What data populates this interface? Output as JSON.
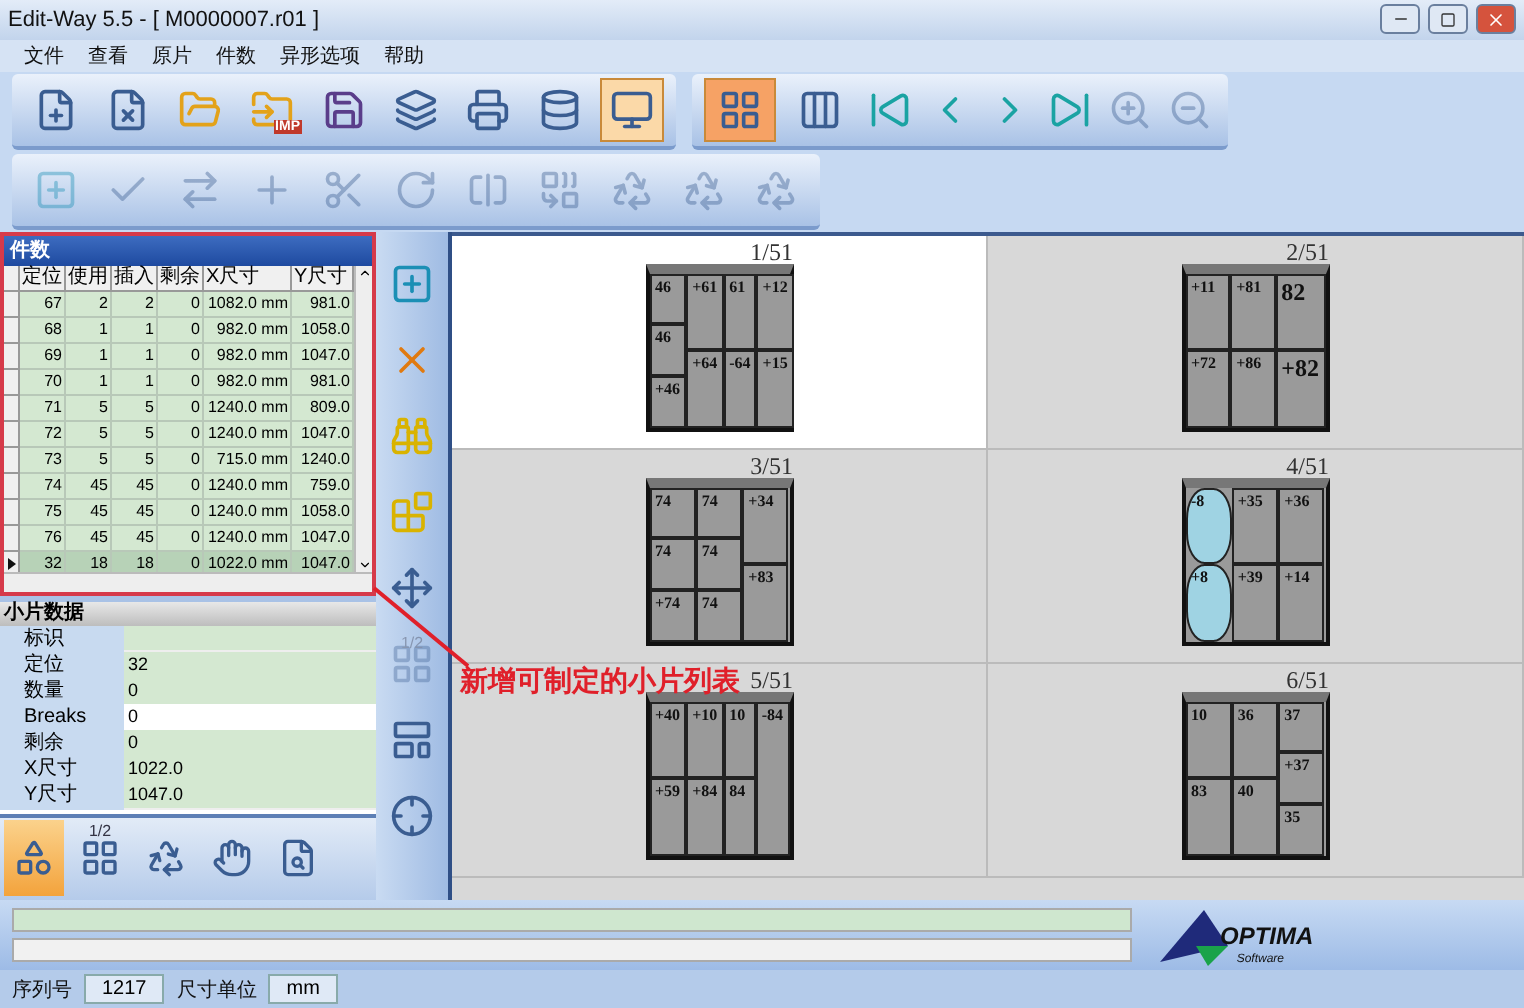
{
  "window": {
    "title": "Edit-Way 5.5  - [ M0000007.r01 ]"
  },
  "menu": [
    "文件",
    "查看",
    "原片",
    "件数",
    "异形选项",
    "帮助"
  ],
  "toolbar_main": [
    {
      "kind": "new",
      "selected": false
    },
    {
      "kind": "close",
      "selected": false
    },
    {
      "kind": "open",
      "selected": false
    },
    {
      "kind": "import",
      "selected": false,
      "label": "IMP"
    },
    {
      "kind": "save",
      "selected": false
    },
    {
      "kind": "layers",
      "selected": false
    },
    {
      "kind": "print",
      "selected": false
    },
    {
      "kind": "stack",
      "selected": false
    },
    {
      "kind": "export",
      "selected": true
    }
  ],
  "toolbar_view": [
    {
      "kind": "grid",
      "selected": true
    },
    {
      "kind": "single",
      "selected": false
    },
    {
      "kind": "first",
      "disabled": false
    },
    {
      "kind": "prev",
      "disabled": false
    },
    {
      "kind": "next",
      "disabled": false
    },
    {
      "kind": "last",
      "disabled": false
    },
    {
      "kind": "zoom-in",
      "disabled": true
    },
    {
      "kind": "zoom-out",
      "disabled": true
    }
  ],
  "toolbar_edit": [
    {
      "kind": "add",
      "disabled": true
    },
    {
      "kind": "check",
      "disabled": true
    },
    {
      "kind": "swap",
      "disabled": true
    },
    {
      "kind": "plus",
      "disabled": true
    },
    {
      "kind": "cut",
      "disabled": true
    },
    {
      "kind": "rotate",
      "disabled": true
    },
    {
      "kind": "split",
      "disabled": true
    },
    {
      "kind": "merge",
      "disabled": true
    },
    {
      "kind": "recycle",
      "disabled": true
    },
    {
      "kind": "recycle",
      "disabled": true
    },
    {
      "kind": "recycle",
      "disabled": true
    }
  ],
  "pieces_panel": {
    "title": "件数",
    "columns": [
      "定位",
      "使用",
      "插入",
      "剩余",
      "X尺寸",
      "Y尺寸"
    ],
    "rows": [
      {
        "cells": [
          "67",
          "2",
          "2",
          "0",
          "1082.0 mm",
          "981.0"
        ],
        "selected": false
      },
      {
        "cells": [
          "68",
          "1",
          "1",
          "0",
          "982.0 mm",
          "1058.0"
        ],
        "selected": false
      },
      {
        "cells": [
          "69",
          "1",
          "1",
          "0",
          "982.0 mm",
          "1047.0"
        ],
        "selected": false
      },
      {
        "cells": [
          "70",
          "1",
          "1",
          "0",
          "982.0 mm",
          "981.0"
        ],
        "selected": false
      },
      {
        "cells": [
          "71",
          "5",
          "5",
          "0",
          "1240.0 mm",
          "809.0"
        ],
        "selected": false
      },
      {
        "cells": [
          "72",
          "5",
          "5",
          "0",
          "1240.0 mm",
          "1047.0"
        ],
        "selected": false
      },
      {
        "cells": [
          "73",
          "5",
          "5",
          "0",
          "715.0 mm",
          "1240.0"
        ],
        "selected": false
      },
      {
        "cells": [
          "74",
          "45",
          "45",
          "0",
          "1240.0 mm",
          "759.0"
        ],
        "selected": false
      },
      {
        "cells": [
          "75",
          "45",
          "45",
          "0",
          "1240.0 mm",
          "1058.0"
        ],
        "selected": false
      },
      {
        "cells": [
          "76",
          "45",
          "45",
          "0",
          "1240.0 mm",
          "1047.0"
        ],
        "selected": false
      },
      {
        "cells": [
          "32",
          "18",
          "18",
          "0",
          "1022.0 mm",
          "1047.0"
        ],
        "selected": true
      }
    ]
  },
  "piece_data": {
    "title": "小片数据",
    "fields": [
      {
        "label": "标识",
        "focused": false
      },
      {
        "label": "定位",
        "value": "32",
        "focused": false
      },
      {
        "label": "数量",
        "value": "0",
        "focused": false
      },
      {
        "label": "Breaks",
        "value": "0",
        "focused": true
      },
      {
        "label": "剩余",
        "value": "0",
        "focused": false
      },
      {
        "label": "X尺寸",
        "value": "1022.0",
        "focused": false
      },
      {
        "label": "Y尺寸",
        "value": "1047.0",
        "focused": false
      }
    ]
  },
  "bottom_tools": [
    {
      "kind": "shapes",
      "selected": true
    },
    {
      "kind": "half",
      "label": "1/2",
      "selected": false
    },
    {
      "kind": "recycle",
      "selected": false
    },
    {
      "kind": "hand",
      "selected": false
    },
    {
      "kind": "preview",
      "selected": false
    }
  ],
  "side_tools": [
    {
      "kind": "add",
      "disabled": false
    },
    {
      "kind": "delete",
      "disabled": false
    },
    {
      "kind": "binoculars",
      "disabled": false
    },
    {
      "kind": "blocks",
      "disabled": false
    },
    {
      "kind": "move",
      "disabled": false
    },
    {
      "kind": "half",
      "label": "1/2",
      "disabled": true
    },
    {
      "kind": "layout",
      "disabled": false
    },
    {
      "kind": "center",
      "disabled": false
    }
  ],
  "sheets": [
    {
      "title": "1/51",
      "selected": true,
      "columns": [
        [
          {
            "label": "46"
          },
          {
            "label": "46"
          },
          {
            "label": "+46"
          }
        ],
        [
          {
            "label": "+61"
          },
          {
            "label": "+64"
          }
        ],
        [
          {
            "label": "61"
          },
          {
            "label": "-64"
          }
        ],
        [
          {
            "label": "+12"
          },
          {
            "label": "+15"
          }
        ]
      ]
    },
    {
      "title": "2/51",
      "selected": false,
      "columns": [
        [
          {
            "label": "+11"
          },
          {
            "label": "+72"
          }
        ],
        [
          {
            "label": "+81"
          },
          {
            "label": "+86"
          }
        ],
        [
          {
            "label": "82",
            "big": true
          },
          {
            "label": "+82",
            "big": true
          }
        ]
      ]
    },
    {
      "title": "3/51",
      "selected": false,
      "columns": [
        [
          {
            "label": "74"
          },
          {
            "label": "74"
          },
          {
            "label": "+74"
          }
        ],
        [
          {
            "label": "74"
          },
          {
            "label": "74"
          },
          {
            "label": "74"
          }
        ],
        [
          {
            "label": "+34"
          },
          {
            "label": "+83"
          }
        ]
      ]
    },
    {
      "title": "4/51",
      "selected": false,
      "columns": [
        [
          {
            "label": "-8",
            "kind": "shaped"
          },
          {
            "label": "+8",
            "kind": "shaped"
          }
        ],
        [
          {
            "label": "+35"
          },
          {
            "label": "+39"
          }
        ],
        [
          {
            "label": "+36"
          },
          {
            "label": "+14"
          }
        ]
      ]
    },
    {
      "title": "5/51",
      "selected": false,
      "columns": [
        [
          {
            "label": "+40"
          },
          {
            "label": "+59"
          }
        ],
        [
          {
            "label": "+10"
          },
          {
            "label": "+84"
          }
        ],
        [
          {
            "label": "10"
          },
          {
            "label": "84"
          }
        ],
        [
          {
            "label": "-84"
          }
        ]
      ]
    },
    {
      "title": "6/51",
      "selected": false,
      "columns": [
        [
          {
            "label": "10"
          },
          {
            "label": "83"
          }
        ],
        [
          {
            "label": "36"
          },
          {
            "label": "40"
          }
        ],
        [
          {
            "label": "37"
          },
          {
            "label": "+37"
          },
          {
            "label": "35"
          }
        ]
      ]
    }
  ],
  "annotation": {
    "text": "新增可制定的小片列表"
  },
  "logo": {
    "name": "OPTIMA",
    "tagline": "Software"
  },
  "status_bar": {
    "serial_label": "序列号",
    "serial": "1217",
    "unit_label": "尺寸单位",
    "unit": "mm"
  }
}
